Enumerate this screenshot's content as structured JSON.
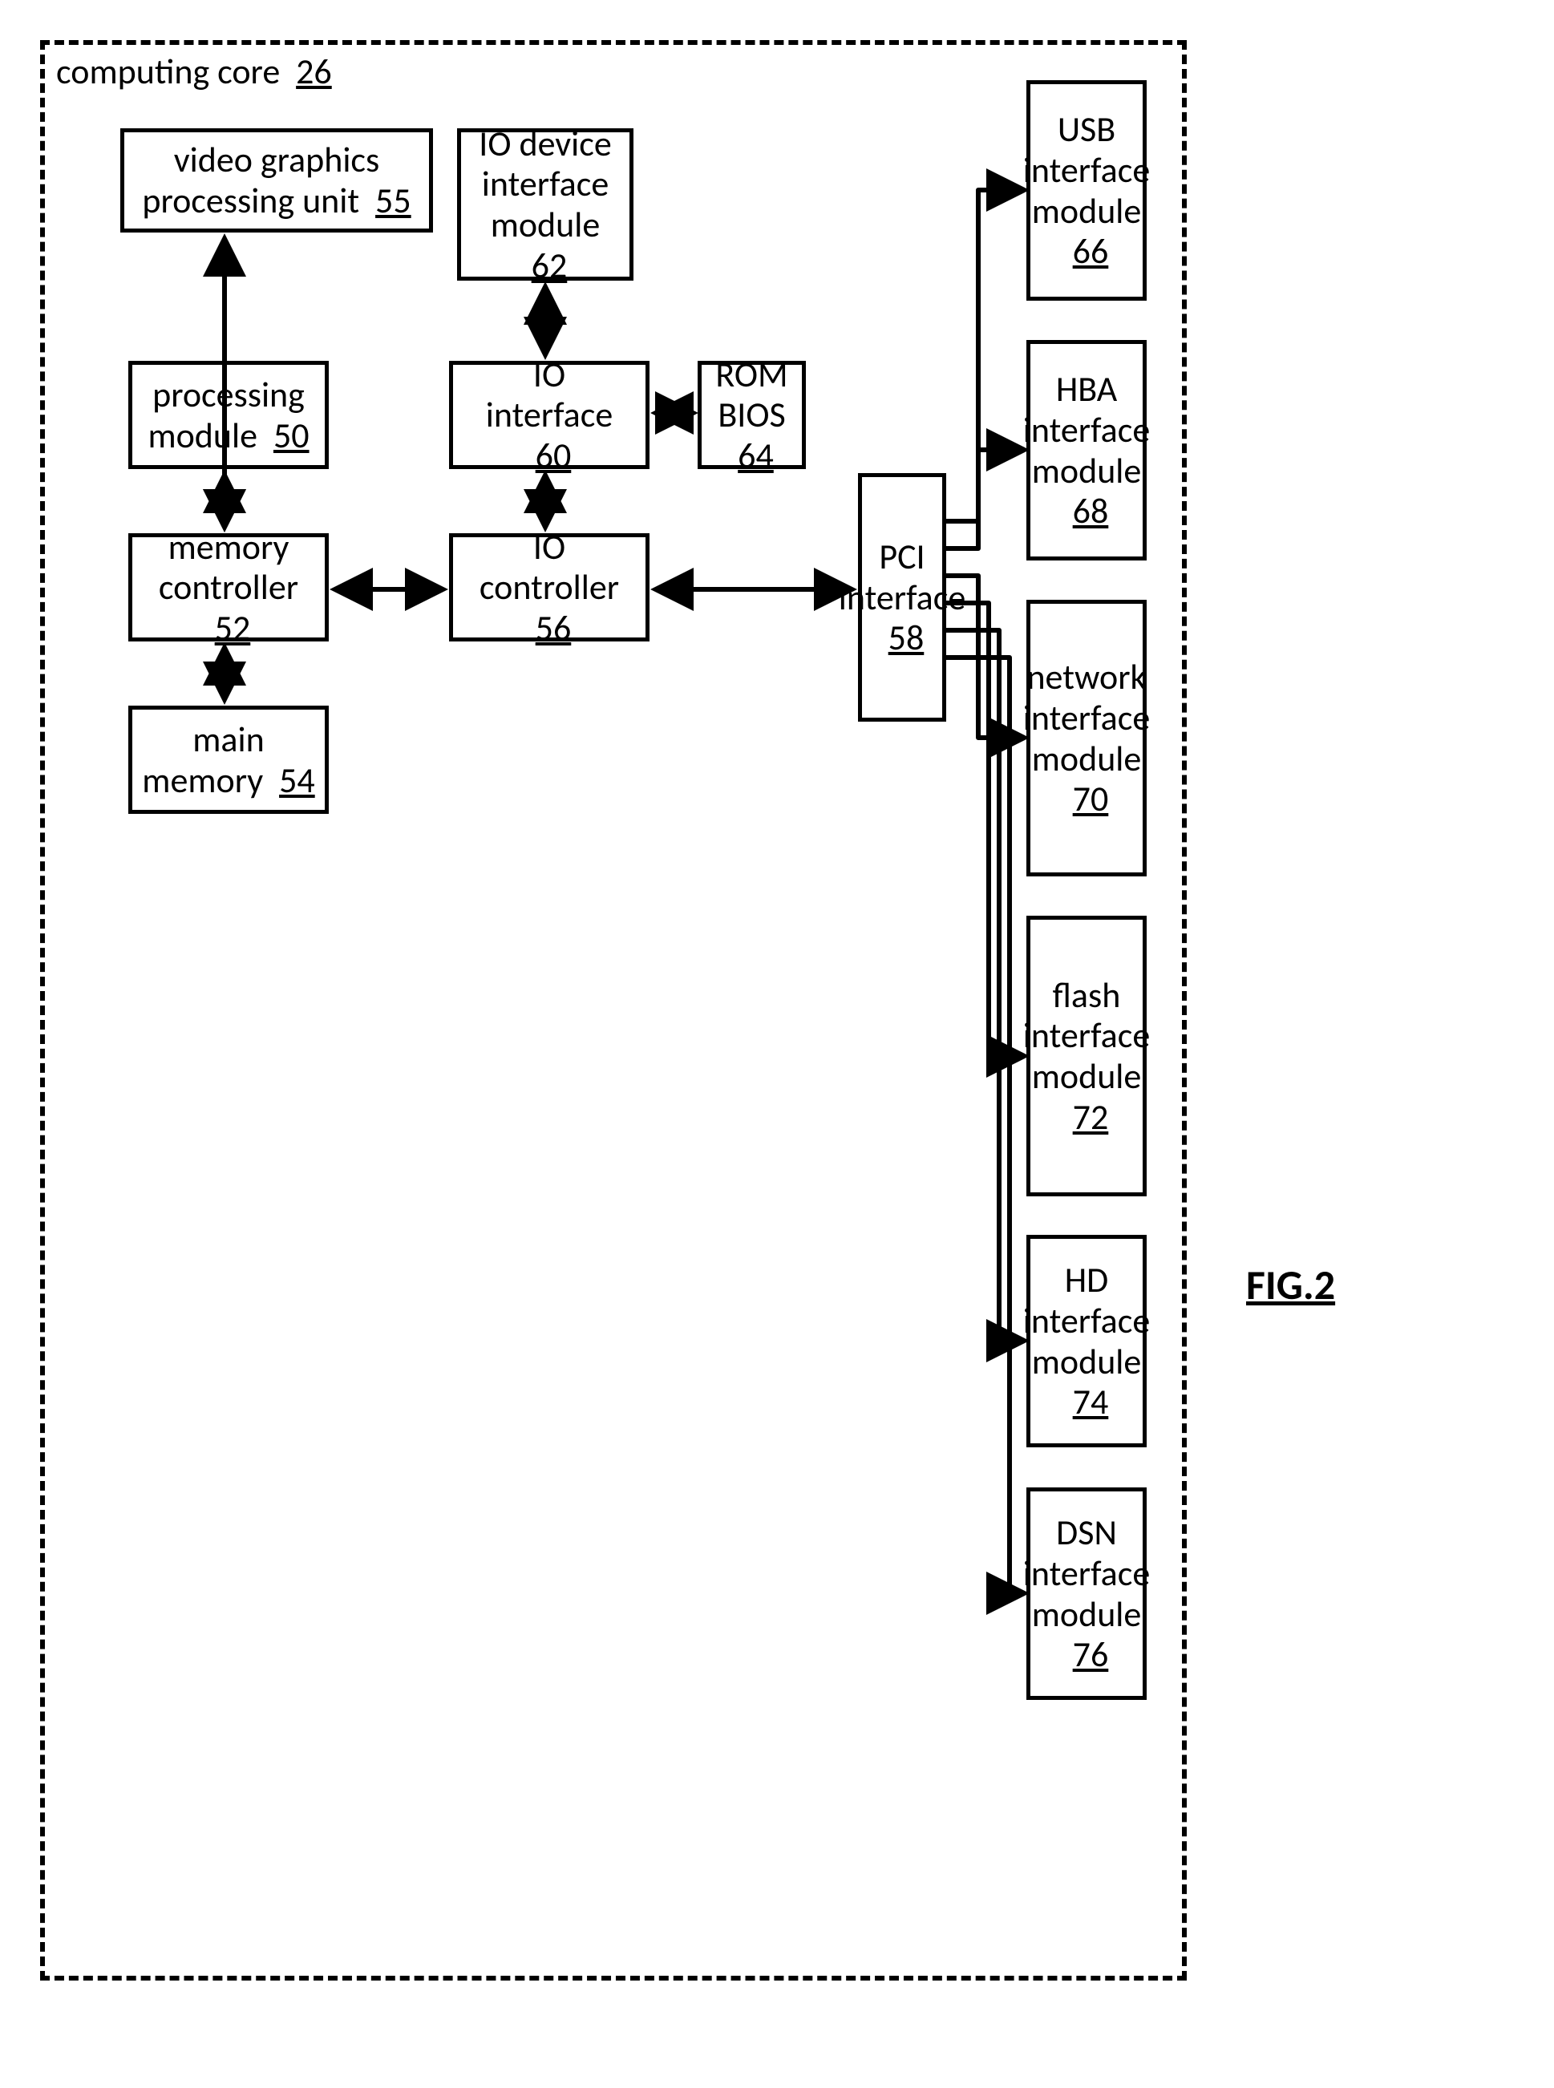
{
  "figure_label": "FIG.2",
  "frame": {
    "label": "computing core",
    "ref": "26"
  },
  "boxes": {
    "vg": {
      "l1": "video graphics",
      "l2": "processing unit",
      "ref": "55"
    },
    "pm": {
      "l1": "processing",
      "l2": "module",
      "ref": "50"
    },
    "mc": {
      "l1": "memory",
      "l2": "controller",
      "ref": "52"
    },
    "mm": {
      "l1": "main",
      "l2": "memory",
      "ref": "54"
    },
    "iod": {
      "l1": "IO device",
      "l2": "interface",
      "l3": "module",
      "ref": "62"
    },
    "ioi": {
      "l1": "IO",
      "l2": "interface",
      "ref": "60"
    },
    "ioc": {
      "l1": "IO",
      "l2": "controller",
      "ref": "56"
    },
    "rom": {
      "l1": "ROM",
      "l2": "BIOS",
      "ref": "64"
    },
    "pci": {
      "l1": "PCI interface",
      "ref": "58"
    },
    "usb": {
      "l1": "USB interface",
      "l2": "module",
      "ref": "66"
    },
    "hba": {
      "l1": "HBA interface",
      "l2": "module",
      "ref": "68"
    },
    "net": {
      "l1": "network interface",
      "l2": "module",
      "ref": "70"
    },
    "fl": {
      "l1": "flash",
      "l2": "interface module",
      "ref": "72"
    },
    "hd": {
      "l1": "HD interface",
      "l2": "module",
      "ref": "74"
    },
    "dsn": {
      "l1": "DSN interface",
      "l2": "module",
      "ref": "76"
    }
  }
}
